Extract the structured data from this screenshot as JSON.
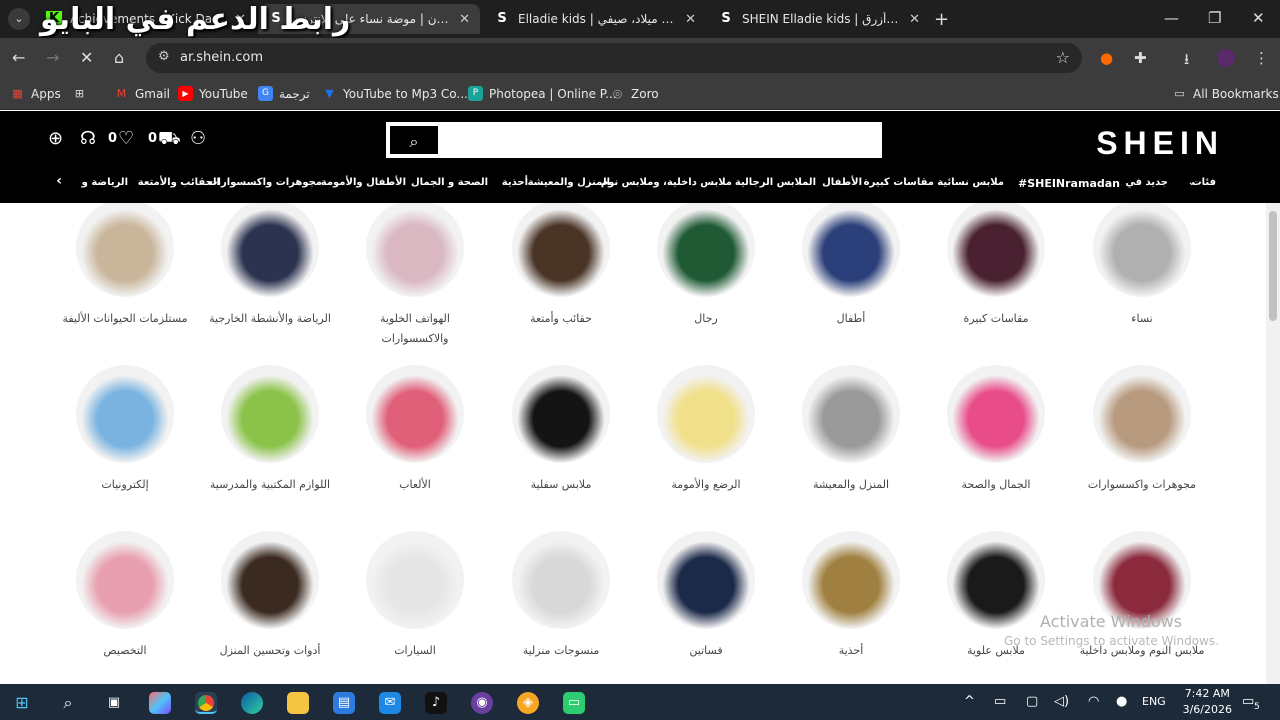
{
  "overlay_title": "رابط الدعم في البايو",
  "tabs": [
    {
      "title": "Achievements - Kick Dashboard",
      "favicon": "kick-icon",
      "color": "#53fc18"
    },
    {
      "title": "شي إن | موضة نساء على الإنترنت",
      "favicon": "shein-icon",
      "color": "#ffffff"
    },
    {
      "title": "Elladie kids | شي إن | عيد ميلاد، صيفي",
      "favicon": "shein-icon",
      "color": "#ffffff"
    },
    {
      "title": "SHEIN Elladie kids | شي إن | أزرق",
      "favicon": "shein-icon",
      "color": "#ffffff"
    }
  ],
  "address": {
    "url": "ar.shein.com"
  },
  "bookmarks": [
    {
      "label": "Apps",
      "icon": "apps-grid-icon",
      "color": "#e8e8e8"
    },
    {
      "label": "Gmail",
      "icon": "gmail-icon",
      "color": "#ea4335"
    },
    {
      "label": "YouTube",
      "icon": "youtube-icon",
      "color": "#ff0000"
    },
    {
      "label": "ترجمة",
      "icon": "translate-icon",
      "color": "#4285f4"
    },
    {
      "label": "YouTube to Mp3 Co...",
      "icon": "converter-icon",
      "color": "#1a73e8"
    },
    {
      "label": "Photopea | Online P...",
      "icon": "photopea-icon",
      "color": "#18a497"
    },
    {
      "label": "Zoro",
      "icon": "zoro-icon",
      "color": "#aaaaaa"
    }
  ],
  "all_bookmarks": "All Bookmarks",
  "shein": {
    "logo": "SHEIN",
    "cart_count": "0",
    "wishlist_count": "0",
    "categories_nav": [
      "فئات",
      "جديد في",
      "SHEINramadan#",
      "ملابس نسائية",
      "مقاسات كبيرة",
      "الأطفال",
      "الملابس الرجالية",
      "ملابس داخلية، وملابس نوم",
      "المنزل والمعيشة",
      "أحذية",
      "الصحة و الجمال",
      "الأطفال والأمومة",
      "مجوهرات واكسسوارات",
      "الحقائب والأمتعة",
      "الرياضة و"
    ]
  },
  "categories": [
    [
      {
        "label": "نساء",
        "color": "#b0b0b0"
      },
      {
        "label": "مقاسات كبيرة",
        "color": "#4a2130"
      },
      {
        "label": "أطفال",
        "color": "#2b3f7a"
      },
      {
        "label": "رجال",
        "color": "#1f5a34"
      },
      {
        "label": "حقائب وأمتعة",
        "color": "#4a3426"
      },
      {
        "label": "الهواتف الخلوية والاكسسوارات",
        "color": "#d9b8c2"
      },
      {
        "label": "الرياضة والأنشطة الخارجية",
        "color": "#2c3350"
      },
      {
        "label": "مستلزمات الحيوانات الأليفة",
        "color": "#c9b59a"
      }
    ],
    [
      {
        "label": "مجوهرات واكسسوارات",
        "color": "#b89a7e"
      },
      {
        "label": "الجمال والصحة",
        "color": "#e84d89"
      },
      {
        "label": "المنزل والمعيشة",
        "color": "#9a9a9a"
      },
      {
        "label": "الرضع والأمومة",
        "color": "#f1e08a"
      },
      {
        "label": "ملابس سفلية",
        "color": "#141414"
      },
      {
        "label": "الألعاب",
        "color": "#e0607a"
      },
      {
        "label": "اللوازم المكتبية والمدرسية",
        "color": "#8bc34a"
      },
      {
        "label": "إلكترونيات",
        "color": "#7ab3e0"
      }
    ],
    [
      {
        "label": "ملابس النوم وملابس داخلية",
        "color": "#8a2a3c"
      },
      {
        "label": "ملابس علوية",
        "color": "#1a1a1a"
      },
      {
        "label": "أحذية",
        "color": "#a08040"
      },
      {
        "label": "فساتين",
        "color": "#1c2a4a"
      },
      {
        "label": "منسوجات منزلية",
        "color": "#d8d8d8"
      },
      {
        "label": "السيارات",
        "color": "#e6e6e6"
      },
      {
        "label": "أدوات وتحسين المنزل",
        "color": "#3a2a20"
      },
      {
        "label": "التخصيص",
        "color": "#e8a0b0"
      }
    ]
  ],
  "watermark": {
    "line1": "Activate Windows",
    "line2": "Go to Settings to activate Windows."
  },
  "taskbar": {
    "lang": "ENG",
    "time": "7:42 AM",
    "date": "3/6/2026",
    "notif_count": "5"
  }
}
